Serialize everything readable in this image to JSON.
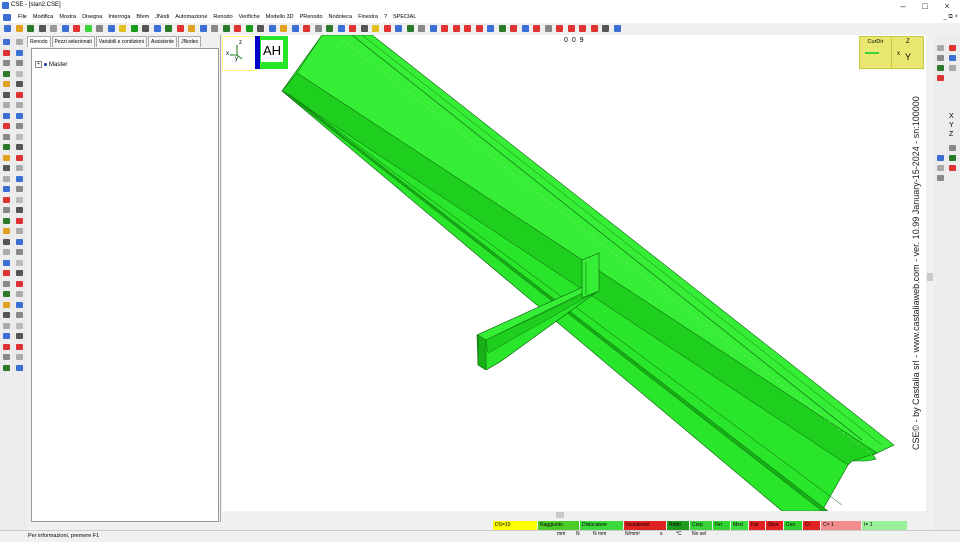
{
  "window": {
    "title": "CSE - [stan2.CSE]",
    "controls": [
      "–",
      "□",
      "×"
    ],
    "mdi_controls": "_ ⧉ ×"
  },
  "menu": [
    "File",
    "Modifica",
    "Mostra",
    "Disegna",
    "Interroga",
    "Bfem",
    "JNodi",
    "Automazione",
    "Renodo",
    "Verifiche",
    "Modello 3D",
    "PRenodo",
    "Nodoteca",
    "Finestra",
    "?",
    "SPECIAL"
  ],
  "panel": {
    "tabs": [
      "Renodo",
      "Pezzi selezionati",
      "Variabili e condizioni",
      "Assistente",
      "JNodes"
    ],
    "tree": {
      "expander": "+",
      "root": "Master"
    }
  },
  "viewport": {
    "axis_z": "z",
    "axis_x": "x",
    "axis_y": "y",
    "ah_label": "AH",
    "coords": "0 0 9",
    "curdir_label": "CurDir",
    "right_axis_z": "Z",
    "right_axis_x": "x",
    "right_axis_y": "Y",
    "watermark": "CSE© - by Castalia srl - www.castaliaweb.com - ver. 10.99 January-15-2024 - sn:100000"
  },
  "right_toolbar": {
    "x": "X",
    "y": "Y",
    "z": "Z"
  },
  "legend": [
    {
      "label": "DS=10",
      "color": "#ffff00"
    },
    {
      "label": "Raggiunto",
      "color": "#4ccc28"
    },
    {
      "label": "Dislocatore",
      "color": "#3cd83c"
    },
    {
      "label": "Incastrone",
      "color": "#dd2020"
    },
    {
      "label": "Rotto",
      "color": "#1e9a1e"
    },
    {
      "label": "Corp",
      "color": "#3ad43a"
    },
    {
      "label": "Fin",
      "color": "#31d331"
    },
    {
      "label": "Med",
      "color": "#40dd40"
    },
    {
      "label": "Fat",
      "color": "#e22222"
    },
    {
      "label": "Sbor",
      "color": "#e22222"
    },
    {
      "label": "Cen",
      "color": "#2fcf2f"
    },
    {
      "label": "Cl",
      "color": "#e22222"
    },
    {
      "label": "C=  1",
      "color": "#f38c8c"
    },
    {
      "label": "I=  1",
      "color": "#9af09a"
    }
  ],
  "units": [
    "mm",
    "N",
    "N mm",
    "N/mm²",
    "s",
    "°C",
    "No sel"
  ],
  "status": {
    "hint": "Per informazioni, premere F1"
  },
  "colors": {
    "member_fill": "#2ae62a",
    "member_dark": "#17b017",
    "member_edge": "#0a5a0a",
    "accent_yellow": "#fafa80",
    "ah_blue": "#0000c8"
  }
}
